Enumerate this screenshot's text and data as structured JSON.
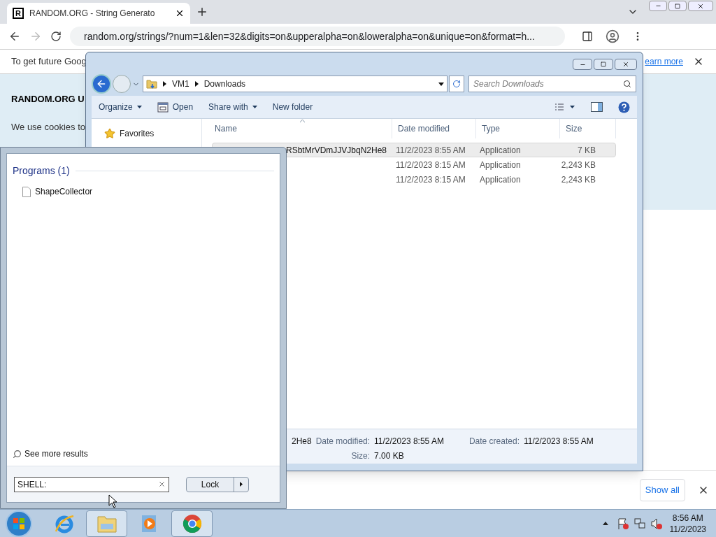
{
  "browser": {
    "tabs": [
      {
        "favicon_letter": "R",
        "title": "RANDOM.ORG - String Generato",
        "selected": true
      }
    ],
    "address": "random.org/strings/?num=1&len=32&digits=on&upperalpha=on&loweralpha=on&unique=on&format=h...",
    "infobar": {
      "text": "To get future Goog",
      "link": "earn more"
    },
    "page": {
      "heading": "RANDOM.ORG U",
      "text": "We use cookies to"
    },
    "downloads_bar": {
      "button": "Show all"
    }
  },
  "explorer": {
    "breadcrumb": [
      "VM1",
      "Downloads"
    ],
    "search": {
      "placeholder": "Search Downloads"
    },
    "toolbar": [
      {
        "kind": "menu",
        "label": "Organize"
      },
      {
        "kind": "open",
        "label": "Open"
      },
      {
        "kind": "menu",
        "label": "Share with"
      },
      {
        "kind": "plain",
        "label": "New folder"
      }
    ],
    "nav": [
      {
        "kind": "favorites",
        "label": "Favorites"
      }
    ],
    "columns": [
      "Name",
      "Date modified",
      "Type",
      "Size"
    ],
    "rows": [
      {
        "name": "RSbtMrVDmJJVJbqN2He8",
        "date": "11/2/2023 8:55 AM",
        "type": "Application",
        "size": "7 KB",
        "selected": true
      },
      {
        "date": "11/2/2023 8:15 AM",
        "type": "Application",
        "size": "2,243 KB",
        "selected": false
      },
      {
        "date": "11/2/2023 8:15 AM",
        "type": "Application",
        "size": "2,243 KB",
        "selected": false
      }
    ],
    "details": {
      "name": "2He8",
      "fields": [
        {
          "label": "Date modified:",
          "value": "11/2/2023 8:55 AM"
        },
        {
          "label": "Date created:",
          "value": "11/2/2023 8:55 AM"
        },
        {
          "label": "Size:",
          "value": "7.00 KB"
        }
      ]
    }
  },
  "start_menu": {
    "section": "Programs (1)",
    "results": [
      "ShapeCollector"
    ],
    "see_more": "See more results",
    "search_value": "SHELL:",
    "power_button": "Lock"
  },
  "taskbar": {
    "apps": [
      {
        "kind": "ie",
        "selected": false
      },
      {
        "kind": "explorer",
        "selected": true
      },
      {
        "kind": "media",
        "selected": false
      },
      {
        "kind": "chrome",
        "selected": true
      }
    ],
    "time": "8:56 AM",
    "date": "11/2/2023"
  }
}
